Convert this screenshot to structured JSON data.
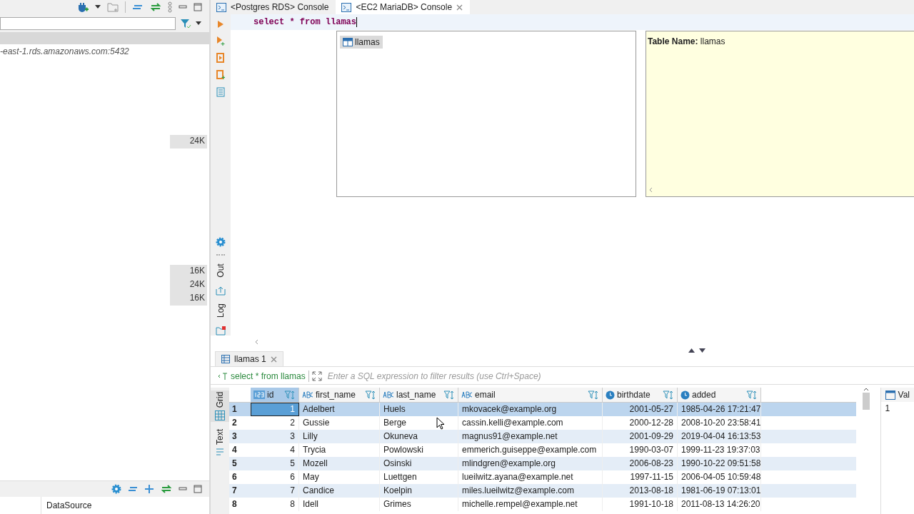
{
  "navigator": {
    "host": "-east-1.rds.amazonaws.com:5432",
    "sizes": [
      {
        "label": "24K"
      },
      {
        "label": "16K"
      },
      {
        "label": "24K"
      },
      {
        "label": "16K"
      }
    ],
    "bottom_panel": {
      "column": "DataSource"
    }
  },
  "tabs": [
    {
      "label": "<Postgres RDS> Console",
      "selected": false,
      "closable": false
    },
    {
      "label": "<EC2 MariaDB> Console",
      "selected": true,
      "closable": true
    }
  ],
  "editor": {
    "query": "select * from llamas",
    "side_tabs": [
      "Out",
      "Log"
    ]
  },
  "autocomplete": {
    "items": [
      {
        "label": "llamas",
        "selected": true
      }
    ],
    "info_label": "Table Name:",
    "info_value": "llamas"
  },
  "results": {
    "tab": "llamas 1",
    "query": "select * from llamas",
    "filter": {
      "placeholder": "Enter a SQL expression to filter results (use Ctrl+Space)"
    },
    "side_tabs": [
      {
        "label": "Grid",
        "selected": true
      },
      {
        "label": "Text",
        "selected": false
      }
    ],
    "columns": [
      {
        "name": "id",
        "kind": "number"
      },
      {
        "name": "first_name",
        "kind": "text"
      },
      {
        "name": "last_name",
        "kind": "text"
      },
      {
        "name": "email",
        "kind": "text"
      },
      {
        "name": "birthdate",
        "kind": "date"
      },
      {
        "name": "added",
        "kind": "date"
      }
    ],
    "rows": [
      {
        "num": "1",
        "selected": true,
        "cells": [
          "1",
          "Adelbert",
          "Huels",
          "mkovacek@example.org",
          "2001-05-27",
          "1985-04-26 17:21:47"
        ]
      },
      {
        "num": "2",
        "selected": false,
        "cells": [
          "2",
          "Gussie",
          "Berge",
          "cassin.kelli@example.com",
          "2000-12-28",
          "2008-10-20 23:58:41"
        ]
      },
      {
        "num": "3",
        "selected": false,
        "cells": [
          "3",
          "Lilly",
          "Okuneva",
          "magnus91@example.net",
          "2001-09-29",
          "2019-04-04 16:13:53"
        ]
      },
      {
        "num": "4",
        "selected": false,
        "cells": [
          "4",
          "Trycia",
          "Powlowski",
          "emmerich.guiseppe@example.com",
          "1990-03-07",
          "1999-11-23 19:37:03"
        ]
      },
      {
        "num": "5",
        "selected": false,
        "cells": [
          "5",
          "Mozell",
          "Osinski",
          "mlindgren@example.org",
          "2006-08-23",
          "1990-10-22 09:51:58"
        ]
      },
      {
        "num": "6",
        "selected": false,
        "cells": [
          "6",
          "May",
          "Luettgen",
          "lueilwitz.ayana@example.net",
          "1997-11-15",
          "2006-04-05 10:59:48"
        ]
      },
      {
        "num": "7",
        "selected": false,
        "cells": [
          "7",
          "Candice",
          "Koelpin",
          "miles.lueilwitz@example.com",
          "2013-08-18",
          "1981-06-19 07:13:01"
        ]
      },
      {
        "num": "8",
        "selected": false,
        "cells": [
          "8",
          "Idell",
          "Grimes",
          "michelle.rempel@example.net",
          "1991-10-18",
          "2011-08-13 14:26:20"
        ]
      }
    ],
    "value_panel": {
      "title": "Val",
      "value": "1"
    }
  }
}
